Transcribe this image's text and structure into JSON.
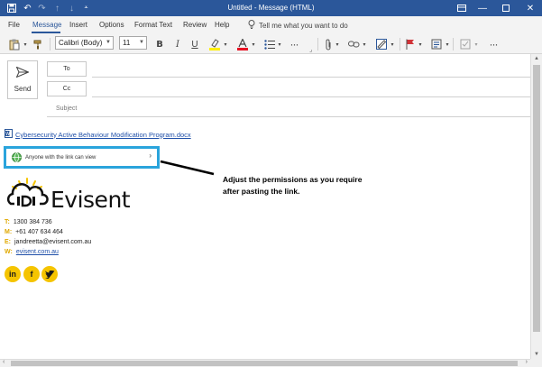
{
  "window": {
    "title": "Untitled  -  Message (HTML)"
  },
  "menu": {
    "items": [
      "File",
      "Message",
      "Insert",
      "Options",
      "Format Text",
      "Review",
      "Help"
    ],
    "active": "Message",
    "tell_me": "Tell me what you want to do"
  },
  "ribbon": {
    "font_name": "Calibri (Body)",
    "font_size": "11",
    "bold": "B",
    "italic": "I",
    "underline": "U"
  },
  "compose": {
    "send_label": "Send",
    "to_label": "To",
    "cc_label": "Cc",
    "subject_label": "Subject"
  },
  "body": {
    "attachment_name": "Cybersecurity Active Behaviour Modification Program.docx",
    "permission_text": "Anyone with the link can view",
    "annotation": "Adjust the permissions as you require after pasting the link.",
    "logo_text": "Evisent",
    "contact": [
      {
        "label": "T:",
        "value": "1300 384 736"
      },
      {
        "label": "M:",
        "value": "+61 407 634 464"
      },
      {
        "label": "E:",
        "value": "jandreetta@evisent.com.au"
      },
      {
        "label": "W:",
        "value": "evisent.com.au"
      }
    ],
    "social": [
      "in",
      "f",
      "t"
    ]
  },
  "colors": {
    "titlebar": "#2b579a",
    "highlight_box": "#2aa4dc",
    "brand_yellow": "#f5c400",
    "link": "#1f4fa8"
  }
}
